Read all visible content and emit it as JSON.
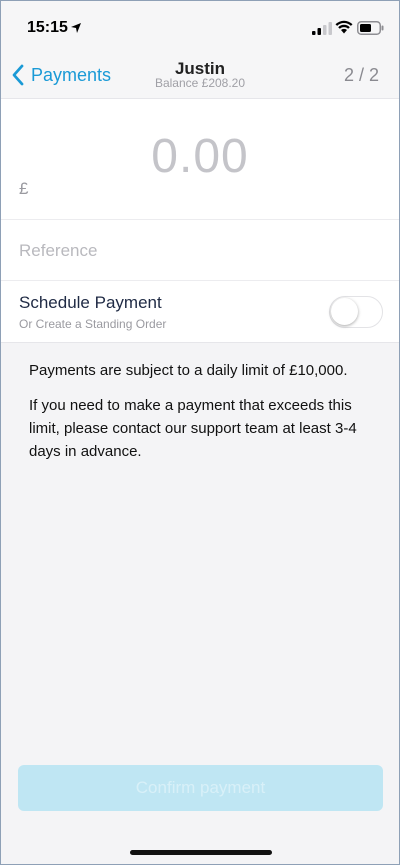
{
  "status_bar": {
    "time": "15:15",
    "icons": [
      "location-arrow-icon",
      "cellular-signal-icon",
      "wifi-icon",
      "battery-icon"
    ]
  },
  "nav": {
    "back_label": "Payments",
    "title": "Justin",
    "subtitle": "Balance £208.20",
    "page_count": "2 / 2"
  },
  "form": {
    "currency_symbol": "£",
    "amount": "0.00",
    "reference_placeholder": "Reference",
    "reference_value": "",
    "schedule_title": "Schedule Payment",
    "schedule_subtitle": "Or Create a Standing Order",
    "schedule_enabled": false
  },
  "info": {
    "paragraph_1": "Payments are subject to a daily limit of £10,000.",
    "paragraph_2": "If you need to make a payment that exceeds this limit, please contact our support team at least 3-4 days in advance."
  },
  "actions": {
    "confirm_label": "Confirm payment",
    "confirm_disabled": true
  },
  "colors": {
    "accent": "#1a9ad6",
    "confirm_bg": "#bfe6f3",
    "background": "#f4f4f6"
  }
}
